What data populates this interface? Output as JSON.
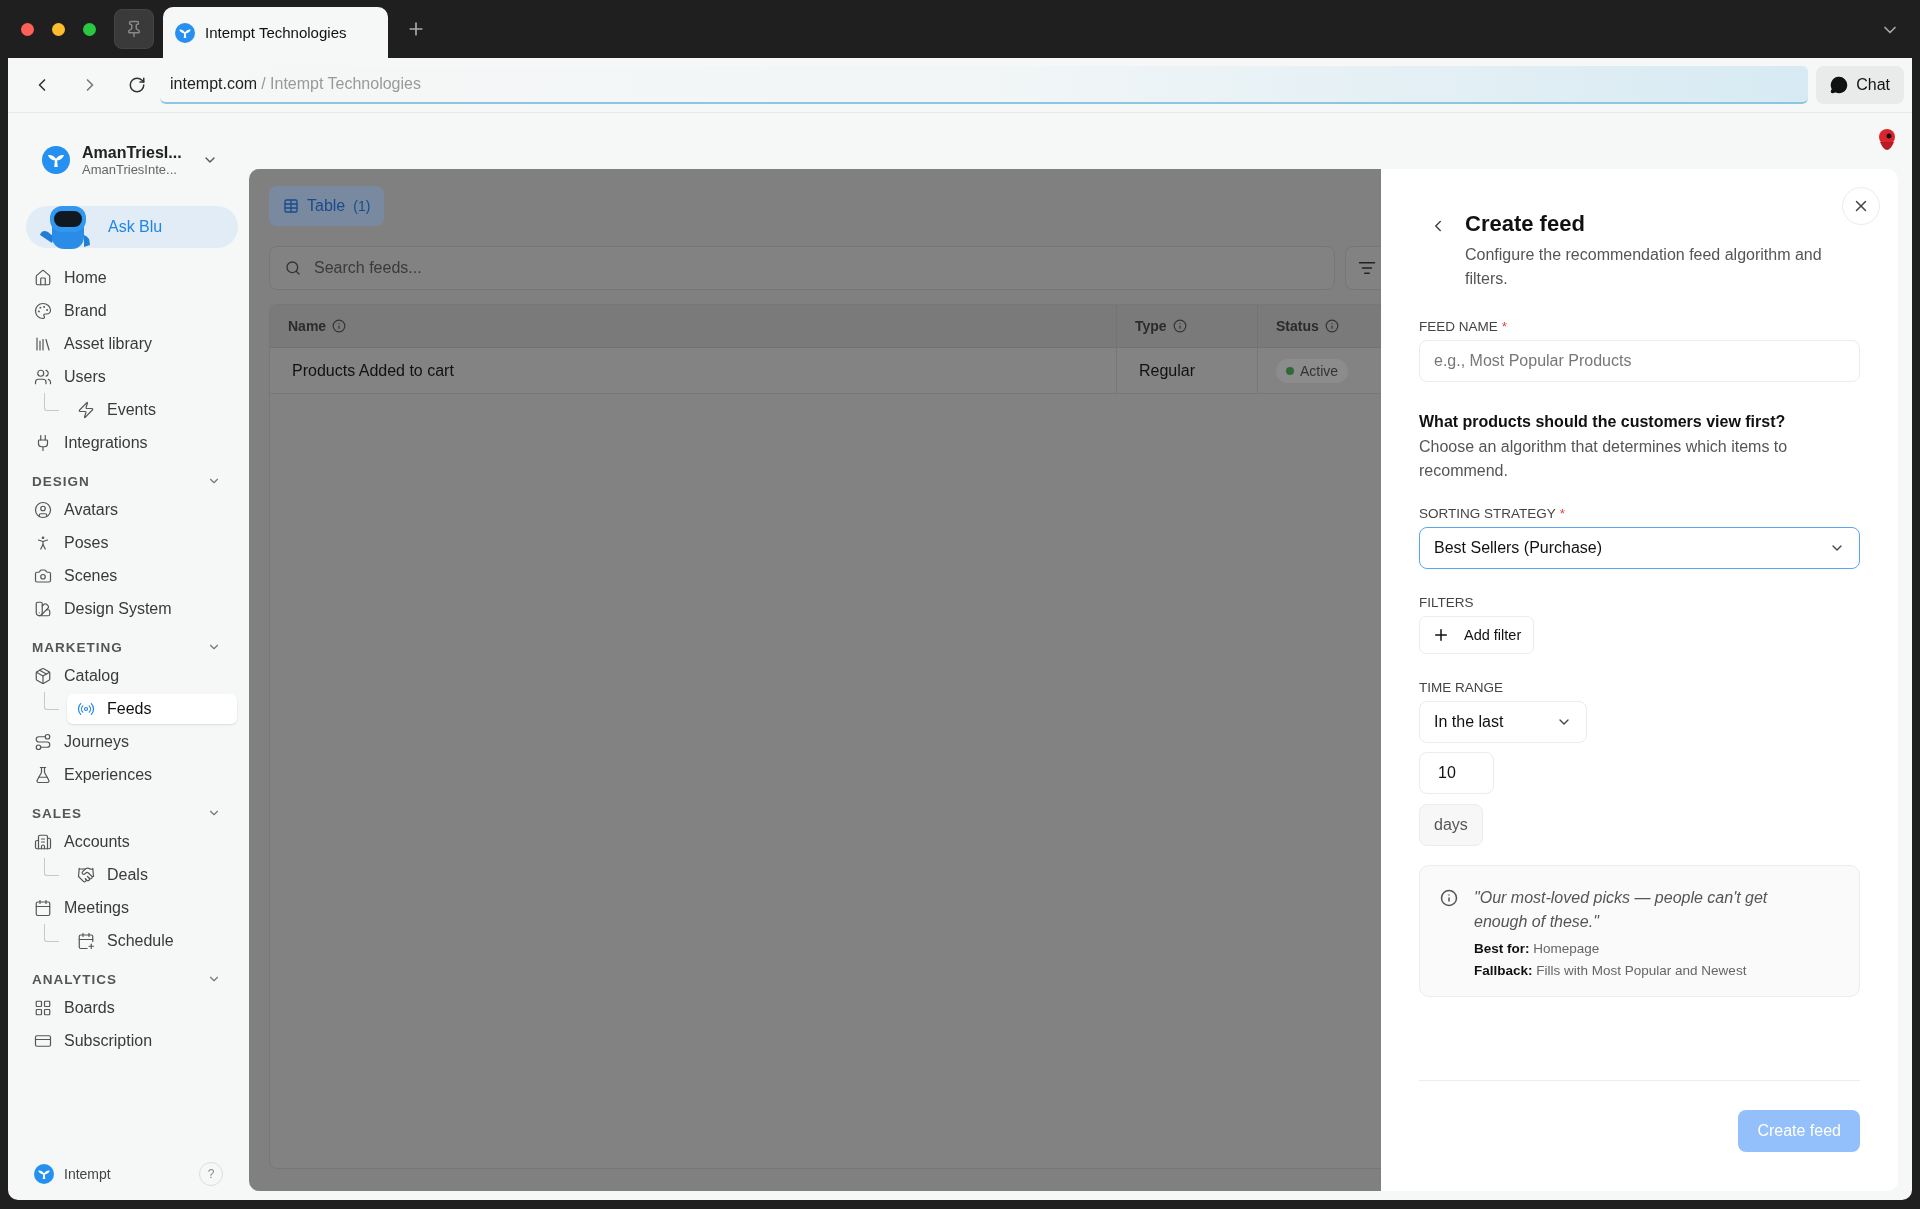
{
  "browser": {
    "tab_title": "Intempt Technologies",
    "url_host": "intempt.com",
    "url_path": "/ Intempt Technologies",
    "chat_button": "Chat"
  },
  "sidebar": {
    "workspace": {
      "name": "AmanTriesI...",
      "subtitle": "AmanTriesInte..."
    },
    "ask_button": "Ask Blu",
    "sections": [
      {
        "items": [
          {
            "label": "Home",
            "selected": false
          },
          {
            "label": "Brand",
            "selected": false
          },
          {
            "label": "Asset library",
            "selected": false
          },
          {
            "label": "Users",
            "selected": false,
            "children": [
              {
                "label": "Events",
                "selected": false
              }
            ]
          },
          {
            "label": "Integrations",
            "selected": false
          }
        ]
      },
      {
        "title": "DESIGN",
        "items": [
          {
            "label": "Avatars",
            "selected": false
          },
          {
            "label": "Poses",
            "selected": false
          },
          {
            "label": "Scenes",
            "selected": false
          },
          {
            "label": "Design System",
            "selected": false
          }
        ]
      },
      {
        "title": "MARKETING",
        "items": [
          {
            "label": "Catalog",
            "selected": false,
            "children": [
              {
                "label": "Feeds",
                "selected": true
              }
            ]
          },
          {
            "label": "Journeys",
            "selected": false
          },
          {
            "label": "Experiences",
            "selected": false
          }
        ]
      },
      {
        "title": "SALES",
        "items": [
          {
            "label": "Accounts",
            "selected": false,
            "children": [
              {
                "label": "Deals",
                "selected": false
              }
            ]
          },
          {
            "label": "Meetings",
            "selected": false,
            "children": [
              {
                "label": "Schedule",
                "selected": false
              }
            ]
          }
        ]
      },
      {
        "title": "ANALYTICS",
        "items": [
          {
            "label": "Boards",
            "selected": false
          },
          {
            "label": "Subscription",
            "selected": false
          }
        ]
      }
    ],
    "footer": {
      "brand": "Intempt",
      "help": "?"
    }
  },
  "main": {
    "view_tab": {
      "label": "Table",
      "count": "(1)"
    },
    "search": {
      "placeholder": "Search feeds..."
    },
    "table": {
      "columns": [
        "Name",
        "Type",
        "Status"
      ],
      "rows": [
        {
          "name": "Products Added to cart",
          "type": "Regular",
          "status": "Active"
        }
      ]
    }
  },
  "panel": {
    "title": "Create feed",
    "description": "Configure the recommendation feed algorithm and filters.",
    "feed_name": {
      "label": "FEED NAME",
      "required_mark": "*",
      "placeholder": "e.g., Most Popular Products"
    },
    "question": {
      "heading": "What products should the customers view first?",
      "text": "Choose an algorithm that determines which items to recommend."
    },
    "sorting": {
      "label": "SORTING STRATEGY",
      "required_mark": "*",
      "value": "Best Sellers (Purchase)",
      "focused": true
    },
    "filters": {
      "label": "FILTERS",
      "button": "Add filter"
    },
    "time_range": {
      "label": "TIME RANGE",
      "value": "In the last",
      "amount": "10",
      "unit": "days"
    },
    "info": {
      "quote": "\"Our most-loved picks — people can't get enough of these.\"",
      "best_for_label": "Best for:",
      "best_for": "Homepage",
      "fallback_label": "Fallback:",
      "fallback": "Fills with Most Popular and Newest"
    },
    "submit": {
      "label": "Create feed",
      "disabled": true
    }
  }
}
